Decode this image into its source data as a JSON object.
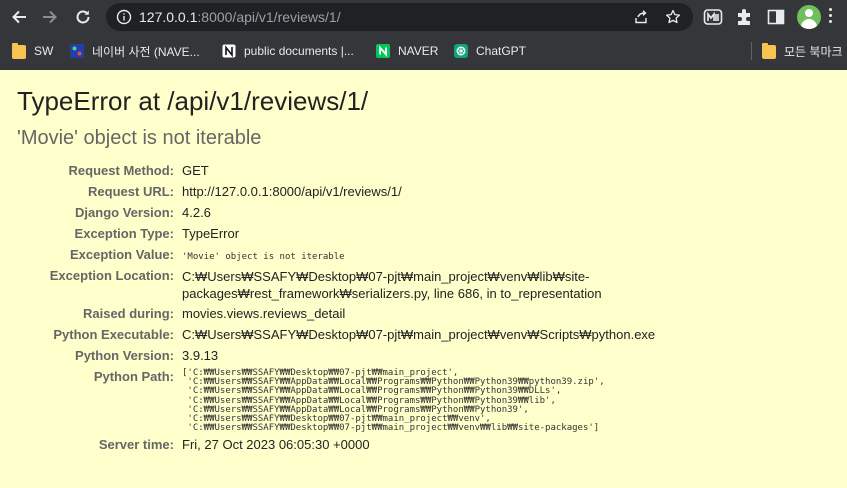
{
  "browser": {
    "url_host": "127.0.0.1",
    "url_rest": ":8000/api/v1/reviews/1/",
    "bookmarks": [
      {
        "label": "SW",
        "icon": "folder-icon"
      },
      {
        "label": "네이버 사전 (NAVE...",
        "icon": "naver-dict-icon"
      },
      {
        "label": "public documents |...",
        "icon": "notion-icon"
      },
      {
        "label": "NAVER",
        "icon": "naver-icon"
      },
      {
        "label": "ChatGPT",
        "icon": "chatgpt-icon"
      },
      {
        "label": "모든 북마크",
        "icon": "folder-icon"
      }
    ],
    "colors": {
      "chrome": "#35363a",
      "omnibox": "#202124",
      "page_bg": "#ffffcc"
    }
  },
  "error": {
    "title": "TypeError at /api/v1/reviews/1/",
    "subtitle": "'Movie' object is not iterable",
    "rows": {
      "request_method": {
        "label": "Request Method:",
        "value": "GET"
      },
      "request_url": {
        "label": "Request URL:",
        "value": "http://127.0.0.1:8000/api/v1/reviews/1/"
      },
      "django_version": {
        "label": "Django Version:",
        "value": "4.2.6"
      },
      "exception_type": {
        "label": "Exception Type:",
        "value": "TypeError"
      },
      "exception_value": {
        "label": "Exception Value:",
        "value": "'Movie' object is not iterable"
      },
      "exception_location": {
        "label": "Exception Location:",
        "value": "C:₩Users₩SSAFY₩Desktop₩07-pjt₩main_project₩venv₩lib₩site-packages₩rest_framework₩serializers.py, line 686, in to_representation"
      },
      "raised_during": {
        "label": "Raised during:",
        "value": "movies.views.reviews_detail"
      },
      "python_executable": {
        "label": "Python Executable:",
        "value": "C:₩Users₩SSAFY₩Desktop₩07-pjt₩main_project₩venv₩Scripts₩python.exe"
      },
      "python_version": {
        "label": "Python Version:",
        "value": "3.9.13"
      },
      "python_path": {
        "label": "Python Path:",
        "value": "['C:₩₩Users₩₩SSAFY₩₩Desktop₩₩07-pjt₩₩main_project',\n 'C:₩₩Users₩₩SSAFY₩₩AppData₩₩Local₩₩Programs₩₩Python₩₩Python39₩₩python39.zip',\n 'C:₩₩Users₩₩SSAFY₩₩AppData₩₩Local₩₩Programs₩₩Python₩₩Python39₩₩DLLs',\n 'C:₩₩Users₩₩SSAFY₩₩AppData₩₩Local₩₩Programs₩₩Python₩₩Python39₩₩lib',\n 'C:₩₩Users₩₩SSAFY₩₩AppData₩₩Local₩₩Programs₩₩Python₩₩Python39',\n 'C:₩₩Users₩₩SSAFY₩₩Desktop₩₩07-pjt₩₩main_project₩₩venv',\n 'C:₩₩Users₩₩SSAFY₩₩Desktop₩₩07-pjt₩₩main_project₩₩venv₩₩lib₩₩site-packages']"
      },
      "server_time": {
        "label": "Server time:",
        "value": "Fri, 27 Oct 2023 06:05:30 +0000"
      }
    }
  }
}
